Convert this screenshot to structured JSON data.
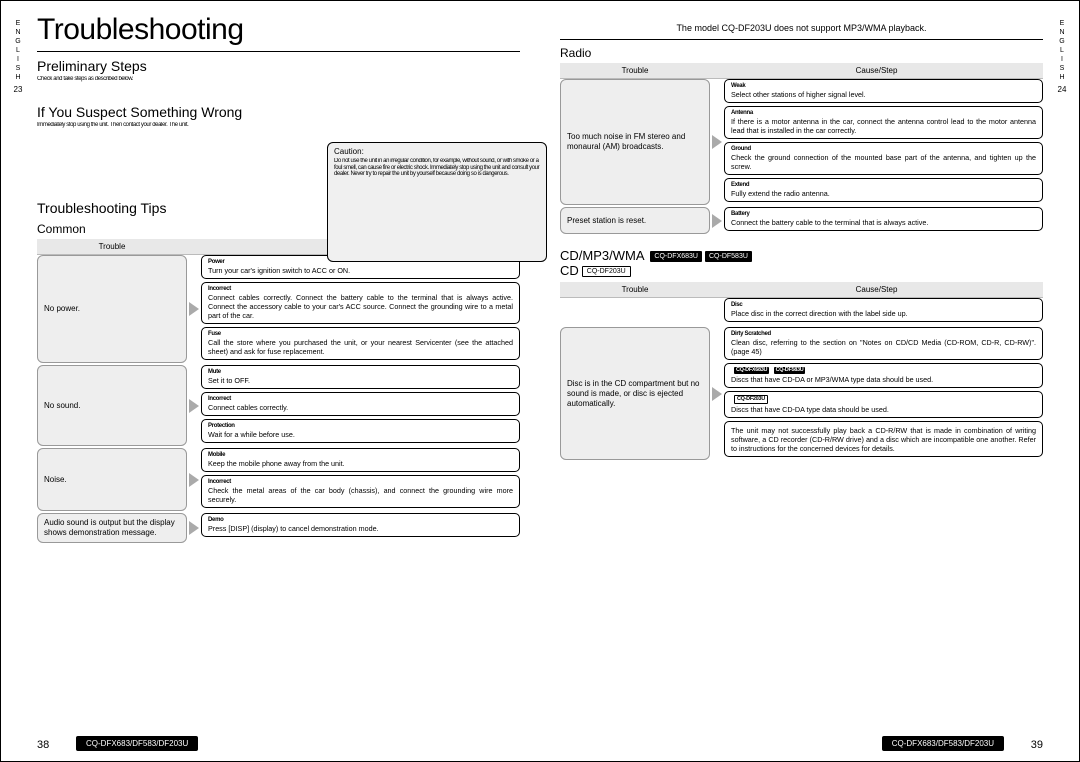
{
  "lang": "ENGLISH",
  "tab_left_page": "23",
  "tab_right_page": "24",
  "title": "Troubleshooting",
  "top_note": "The model CQ-DF203U does not support MP3/WMA playback.",
  "secA": "Preliminary Steps",
  "secA_body": "Check and take steps as described\nbelow.",
  "secB": "If You Suspect Something Wrong",
  "secB_body": "Immediately\nstop using the unit.\nThen\ncontact your dealer.\nThe\nunit.",
  "caution_title": "Caution:",
  "caution_body": "Do not use the unit in an\nirregular condition,\nfor example, without sound,\nor with smoke or a foul smell,\ncan cause fire or electric shock.\nImmediately stop using the unit\nand consult your dealer.\nNever try to repair the unit by yourself\nbecause doing so is dangerous.",
  "secC": "Troubleshooting Tips",
  "sub_common": "Common",
  "hdr_trouble": "Trouble",
  "hdr_cause": "Cause/Step",
  "common_rows": [
    {
      "trouble": "No power.",
      "steps": [
        {
          "lead": "Power",
          "body": "Turn your car's ignition switch to ACC or ON."
        },
        {
          "lead": "Incorrect",
          "body": "Connect cables correctly.\nConnect the battery cable to the terminal that is always active.\nConnect the accessory cable to your car's ACC source.\nConnect the grounding wire to a metal part of the car."
        },
        {
          "lead": "Fuse",
          "body": "Call the store where you purchased the unit, or your nearest Servicenter (see the attached sheet) and ask for fuse replacement."
        }
      ]
    },
    {
      "trouble": "No sound.",
      "steps": [
        {
          "lead": "Mute",
          "body": "Set it to OFF."
        },
        {
          "lead": "Incorrect",
          "body": "Connect cables correctly."
        },
        {
          "lead": "Protection",
          "body": "Wait for a while before use."
        }
      ]
    },
    {
      "trouble": "Noise.",
      "steps": [
        {
          "lead": "Mobile",
          "body": "Keep the mobile phone away from the unit."
        },
        {
          "lead": "Incorrect",
          "body": "Check the metal areas of the car body (chassis), and connect the grounding wire more securely."
        }
      ]
    },
    {
      "trouble": "Audio sound is output but the display shows demonstration message.",
      "steps": [
        {
          "lead": "Demo",
          "body": "Press [DISP] (display) to cancel demonstration mode."
        }
      ]
    }
  ],
  "sec_radio": "Radio",
  "radio_rows": [
    {
      "trouble": "Too much noise in FM stereo and monaural (AM) broadcasts.",
      "steps": [
        {
          "lead": "Weak",
          "body": "Select other stations of higher signal level."
        },
        {
          "lead": "Antenna",
          "body": "If there is a motor antenna in the car, connect the antenna control lead to the motor antenna lead that is installed in the car correctly."
        },
        {
          "lead": "Ground",
          "body": "Check the ground connection of the mounted base part of the antenna, and tighten up the screw."
        },
        {
          "lead": "Extend",
          "body": "Fully extend the radio antenna."
        }
      ]
    },
    {
      "trouble": "Preset station is reset.",
      "steps": [
        {
          "lead": "Battery",
          "body": "Connect the battery cable to the terminal that is always active."
        }
      ]
    }
  ],
  "sec_cd": "CD/MP3/WMA",
  "sec_cd2": "CD",
  "badge1": "CQ-DFX683U",
  "badge2": "CQ-DF583U",
  "badge3": "CQ-DF203U",
  "cd_rows": [
    {
      "trouble": "",
      "steps": [
        {
          "lead": "Disc",
          "body": "Place disc in the correct direction with the label side up."
        }
      ]
    },
    {
      "trouble": "Disc is in the CD compartment but no sound is made, or disc is ejected automatically.",
      "steps": [
        {
          "lead": "Dirty\nScratched",
          "body": "Clean disc, referring to the section on \"Notes on CD/CD Media (CD-ROM, CD-R, CD-RW)\". (page 45)"
        },
        {
          "lead": "Data badges1",
          "body": "Discs that have CD-DA or MP3/WMA type data should be used."
        },
        {
          "lead": "Data badge3",
          "body": "Discs that have CD-DA type data should be used."
        },
        {
          "lead": "",
          "body": "The unit may not successfully play back a CD-R/RW that is made in combination of writing software, a CD recorder (CD-R/RW drive) and a disc which are incompatible one another. Refer to instructions for the concerned devices for details."
        }
      ]
    }
  ],
  "footer_models": "CQ-DFX683/DF583/DF203U",
  "pg_left": "38",
  "pg_right": "39"
}
